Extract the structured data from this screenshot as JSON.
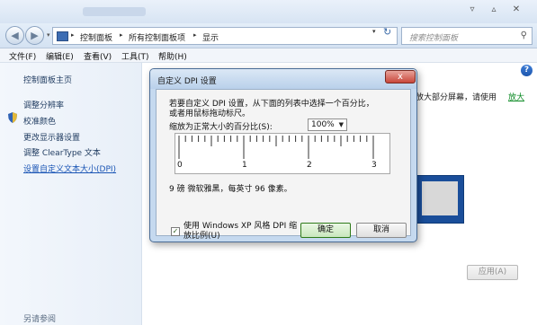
{
  "nav": {
    "breadcrumbs": [
      "控制面板",
      "所有控制面板项",
      "显示"
    ],
    "search_placeholder": "搜索控制面板"
  },
  "menu": [
    "文件(F)",
    "编辑(E)",
    "查看(V)",
    "工具(T)",
    "帮助(H)"
  ],
  "sidebar": {
    "items": [
      "控制面板主页",
      "调整分辨率",
      "校准颜色",
      "更改显示器设置",
      "调整 ClearType 文本",
      "设置自定义文本大小(DPI)"
    ],
    "see_also": "另请参阅"
  },
  "main": {
    "text_fragment": "放大部分屏幕，请使用",
    "link_fragment": "放大",
    "apply_label": "应用(A)"
  },
  "dialog": {
    "title": "自定义 DPI 设置",
    "instruction_line1": "若要自定义 DPI 设置，从下面的列表中选择一个百分比，",
    "instruction_line2": "或者用鼠标拖动标尺。",
    "scale_label": "缩放为正常大小的百分比(S):",
    "scale_value": "100%",
    "ruler_labels": [
      "0",
      "1",
      "2",
      "3"
    ],
    "font_info": "9 磅 微软雅黑，每英寸 96 像素。",
    "checkbox_label_line1": "使用 Windows XP 风格 DPI 缩",
    "checkbox_label_line2": "放比例(U)",
    "checkbox_checked": true,
    "ok_label": "确定",
    "cancel_label": "取消",
    "close_glyph": "x"
  },
  "icons": {
    "back": "back-arrow-icon",
    "forward": "forward-arrow-icon",
    "refresh": "refresh-icon",
    "search": "search-icon",
    "help": "help-icon",
    "shield": "shield-icon"
  }
}
